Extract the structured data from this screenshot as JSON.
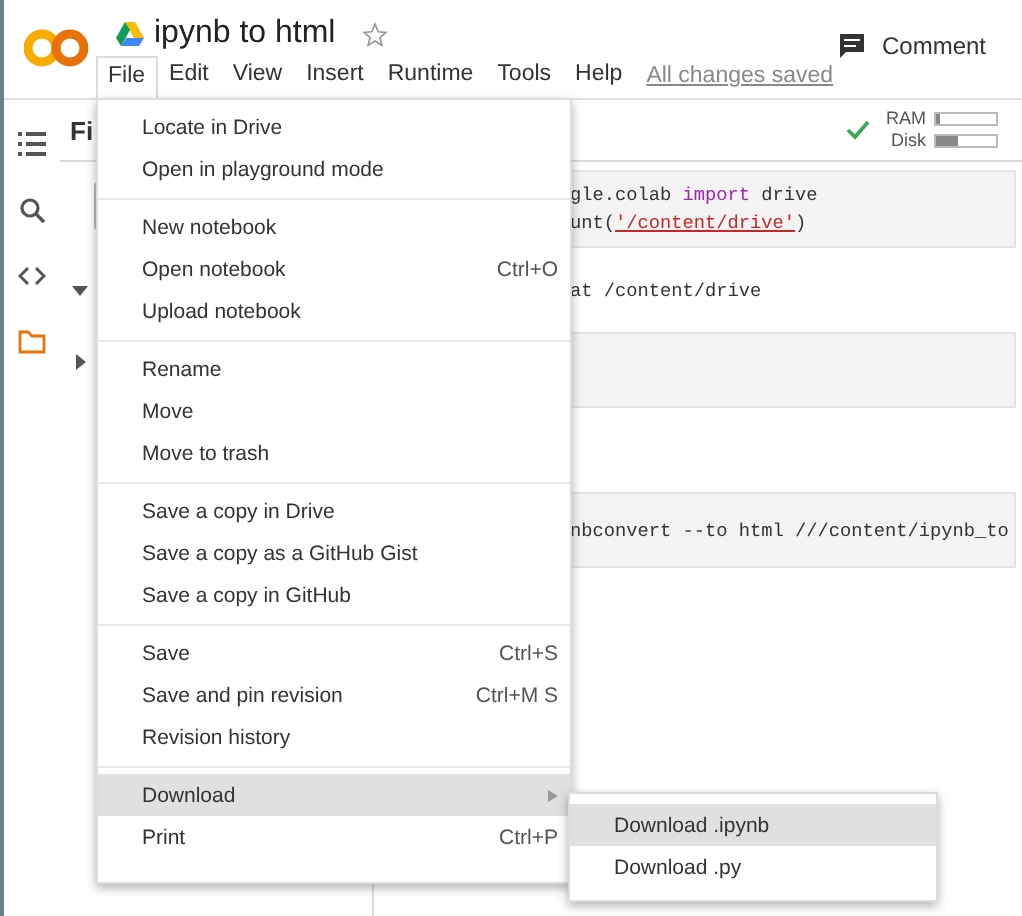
{
  "header": {
    "title": "ipynb to html",
    "starred": false,
    "comment_label": "Comment"
  },
  "menu_bar": [
    {
      "label": "File",
      "selected": true
    },
    {
      "label": "Edit",
      "selected": false
    },
    {
      "label": "View",
      "selected": false
    },
    {
      "label": "Insert",
      "selected": false
    },
    {
      "label": "Runtime",
      "selected": false
    },
    {
      "label": "Tools",
      "selected": false
    },
    {
      "label": "Help",
      "selected": false
    }
  ],
  "save_status": "All changes saved",
  "resources": {
    "connected": true,
    "ram": {
      "label": "RAM",
      "level": 0.05
    },
    "disk": {
      "label": "Disk",
      "level": 0.35
    }
  },
  "rail": [
    {
      "kind": "menu",
      "selected": false
    },
    {
      "kind": "search",
      "selected": false
    },
    {
      "kind": "code",
      "selected": false
    },
    {
      "kind": "folder",
      "selected": true
    }
  ],
  "files_panel": {
    "title": "Fi",
    "tree": [
      {
        "expanded": true
      },
      {
        "expanded": false
      }
    ]
  },
  "cells": [
    {
      "kind": "code",
      "lines": [
        [
          {
            "text": "gle.colab ",
            "kind": "plain"
          },
          {
            "text": "import",
            "kind": "keyword"
          },
          {
            "text": " drive",
            "kind": "plain"
          }
        ],
        [
          {
            "text": "unt(",
            "kind": "plain"
          },
          {
            "text": "'/content/drive'",
            "kind": "string"
          },
          {
            "text": ")",
            "kind": "plain"
          }
        ]
      ]
    },
    {
      "kind": "output",
      "lines": [
        [
          {
            "text": "at /content/drive",
            "kind": "plain"
          }
        ]
      ]
    },
    {
      "kind": "code"
    },
    {
      "kind": "output"
    },
    {
      "kind": "code",
      "lines": [
        [
          {
            "text": "nbconvert --to html ///content/ipynb_to",
            "kind": "plain"
          }
        ]
      ]
    }
  ],
  "file_menu": {
    "groups": [
      [
        {
          "label": "Locate in Drive",
          "selected": false
        },
        {
          "label": "Open in playground mode",
          "selected": false
        }
      ],
      [
        {
          "label": "New notebook",
          "selected": false
        },
        {
          "label": "Open notebook",
          "shortcut": "Ctrl+O",
          "selected": false
        },
        {
          "label": "Upload notebook",
          "selected": false
        }
      ],
      [
        {
          "label": "Rename",
          "selected": false
        },
        {
          "label": "Move",
          "selected": false
        },
        {
          "label": "Move to trash",
          "selected": false
        }
      ],
      [
        {
          "label": "Save a copy in Drive",
          "selected": false
        },
        {
          "label": "Save a copy as a GitHub Gist",
          "selected": false
        },
        {
          "label": "Save a copy in GitHub",
          "selected": false
        }
      ],
      [
        {
          "label": "Save",
          "shortcut": "Ctrl+S",
          "selected": false
        },
        {
          "label": "Save and pin revision",
          "shortcut": "Ctrl+M S",
          "selected": false
        },
        {
          "label": "Revision history",
          "selected": false
        }
      ],
      [
        {
          "label": "Download",
          "submenu": true,
          "selected": true
        },
        {
          "label": "Print",
          "shortcut": "Ctrl+P",
          "selected": false
        }
      ]
    ]
  },
  "download_submenu": [
    {
      "label": "Download .ipynb",
      "selected": true
    },
    {
      "label": "Download .py",
      "selected": false
    }
  ]
}
